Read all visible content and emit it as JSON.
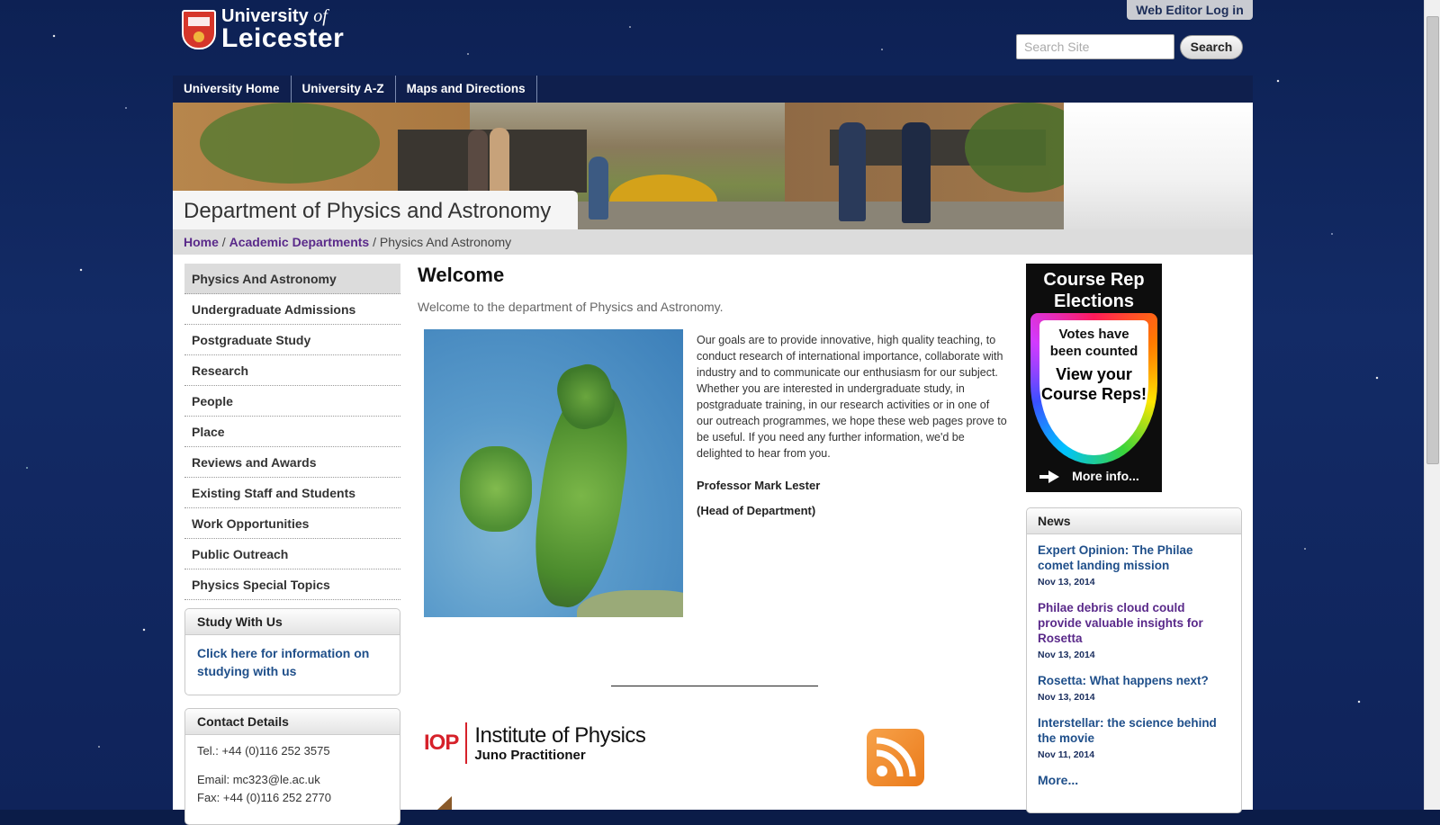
{
  "header": {
    "logo": {
      "line1_main": "University",
      "line1_em": "of",
      "line2": "Leicester"
    },
    "web_editor_label": "Web Editor Log in",
    "search_placeholder": "Search Site",
    "search_button": "Search"
  },
  "topnav": [
    "University Home",
    "University A-Z",
    "Maps and Directions"
  ],
  "department_title": "Department of Physics and Astronomy",
  "breadcrumb": {
    "home": "Home",
    "sep": "/",
    "section": "Academic Departments",
    "current": "Physics And Astronomy"
  },
  "leftnav": [
    "Physics And Astronomy",
    "Undergraduate Admissions",
    "Postgraduate Study",
    "Research",
    "People",
    "Place",
    "Reviews and Awards",
    "Existing Staff and Students",
    "Work Opportunities",
    "Public Outreach",
    "Physics Special Topics"
  ],
  "study_box": {
    "title": "Study With Us",
    "link": "Click here for information on studying with us"
  },
  "contact_box": {
    "title": "Contact Details",
    "tel": "Tel.: +44 (0)116 252 3575",
    "email": "Email: mc323@le.ac.uk",
    "fax": "Fax: +44 (0)116 252 2770"
  },
  "main": {
    "heading": "Welcome",
    "intro": "Welcome to the department of Physics and Astronomy.",
    "body": "Our goals are to provide innovative, high quality teaching, to conduct research of international importance, collaborate with industry and to communicate our enthusiasm for our subject. Whether you are interested in undergraduate study, in postgraduate training, in our research activities or in one of our outreach programmes, we hope these web pages prove to be useful. If you need any further information, we'd be delighted to hear from you.",
    "signature_name": "Professor Mark Lester",
    "signature_role": "(Head of Department)",
    "iop": {
      "mark": "IOP",
      "name": "Institute of Physics",
      "sub": "Juno Practitioner"
    }
  },
  "ad": {
    "heading1": "Course Rep",
    "heading2": "Elections",
    "votes1": "Votes have",
    "votes2": "been counted",
    "view1": "View your",
    "view2": "Course Reps!",
    "more": "More info..."
  },
  "news": {
    "title": "News",
    "items": [
      {
        "title": "Expert Opinion: The Philae comet landing mission",
        "date": "Nov 13, 2014"
      },
      {
        "title": "Philae debris cloud could provide valuable insights for Rosetta",
        "date": "Nov 13, 2014"
      },
      {
        "title": "Rosetta: What happens next?",
        "date": "Nov 13, 2014"
      },
      {
        "title": "Interstellar: the science behind the movie",
        "date": "Nov 11, 2014"
      }
    ],
    "more": "More..."
  }
}
